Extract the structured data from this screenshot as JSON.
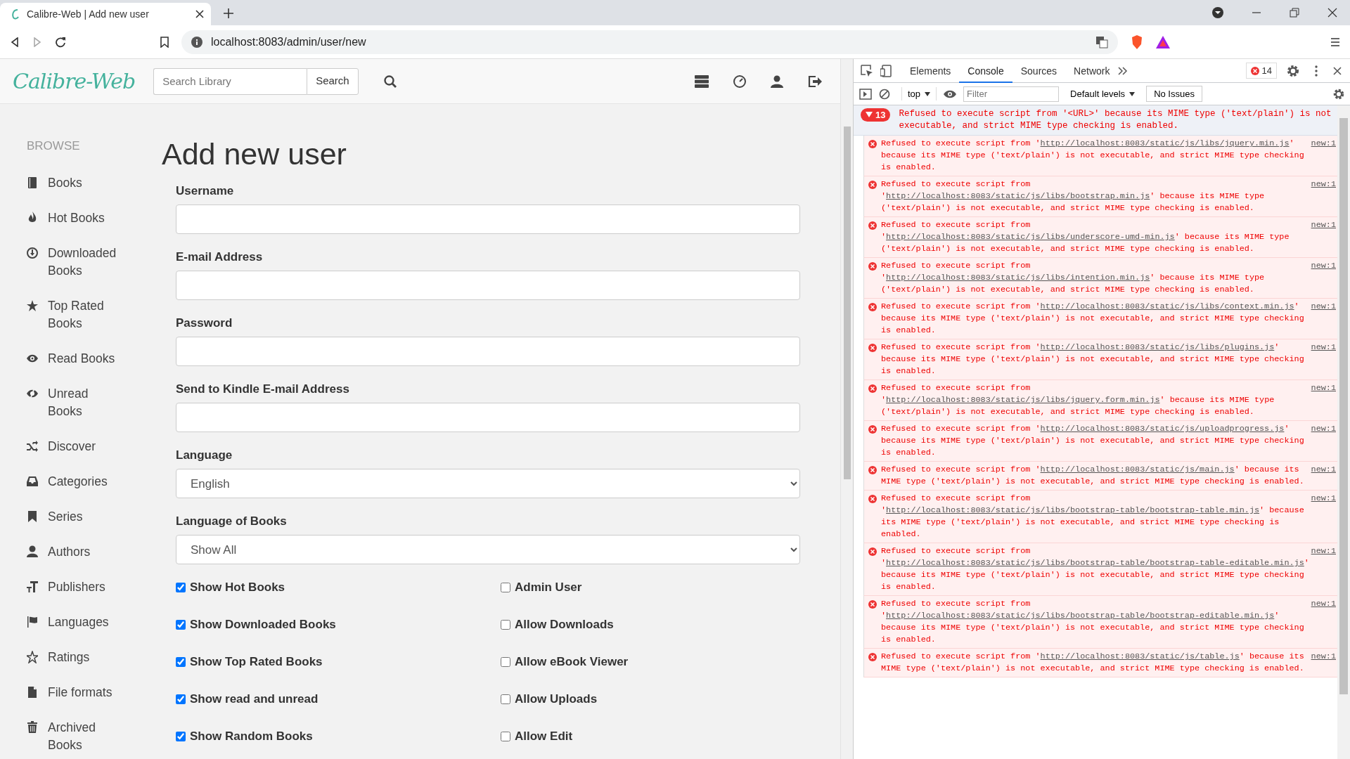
{
  "browser": {
    "tab_title": "Calibre-Web | Add new user",
    "url": "localhost:8083/admin/user/new"
  },
  "header": {
    "logo": "Calibre-Web",
    "search_placeholder": "Search Library",
    "search_button": "Search"
  },
  "sidebar": {
    "heading": "BROWSE",
    "items": [
      {
        "label": "Books"
      },
      {
        "label": "Hot Books"
      },
      {
        "label": "Downloaded Books"
      },
      {
        "label": "Top Rated Books"
      },
      {
        "label": "Read Books"
      },
      {
        "label": "Unread Books"
      },
      {
        "label": "Discover"
      },
      {
        "label": "Categories"
      },
      {
        "label": "Series"
      },
      {
        "label": "Authors"
      },
      {
        "label": "Publishers"
      },
      {
        "label": "Languages"
      },
      {
        "label": "Ratings"
      },
      {
        "label": "File formats"
      },
      {
        "label": "Archived Books"
      }
    ]
  },
  "form": {
    "title": "Add new user",
    "fields": [
      {
        "label": "Username",
        "kind": "text"
      },
      {
        "label": "E-mail Address",
        "kind": "text"
      },
      {
        "label": "Password",
        "kind": "password"
      },
      {
        "label": "Send to Kindle E-mail Address",
        "kind": "text"
      },
      {
        "label": "Language",
        "kind": "select",
        "value": "English"
      },
      {
        "label": "Language of Books",
        "kind": "select",
        "value": "Show All"
      }
    ],
    "checkboxes_left": [
      {
        "label": "Show Hot Books",
        "checked": true
      },
      {
        "label": "Show Downloaded Books",
        "checked": true
      },
      {
        "label": "Show Top Rated Books",
        "checked": true
      },
      {
        "label": "Show read and unread",
        "checked": true
      },
      {
        "label": "Show Random Books",
        "checked": true
      }
    ],
    "checkboxes_right": [
      {
        "label": "Admin User",
        "checked": false
      },
      {
        "label": "Allow Downloads",
        "checked": false
      },
      {
        "label": "Allow eBook Viewer",
        "checked": false
      },
      {
        "label": "Allow Uploads",
        "checked": false
      },
      {
        "label": "Allow Edit",
        "checked": false
      }
    ]
  },
  "devtools": {
    "tabs": [
      {
        "label": "Elements",
        "selected": false
      },
      {
        "label": "Console",
        "selected": true
      },
      {
        "label": "Sources",
        "selected": false
      },
      {
        "label": "Network",
        "selected": false
      }
    ],
    "error_count": "14",
    "context": "top",
    "filter_placeholder": "Filter",
    "levels": "Default levels",
    "issues": "No Issues",
    "group": {
      "count": "13",
      "expanded": true,
      "text": "Refused to execute script from '<URL>' because its MIME type ('text/plain') is not executable, and strict MIME type checking is enabled."
    },
    "messages": [
      {
        "prefix": "Refused to execute script from '",
        "url": "http://localhost:8083/static/js/libs/jquery.min.js",
        "suffix": "' because its MIME type ('text/plain') is not executable, and strict MIME type checking is enabled.",
        "source": "new:1"
      },
      {
        "prefix": "Refused to execute script from '",
        "url": "http://localhost:8083/static/js/libs/bootstrap.min.js",
        "suffix": "' because its MIME type ('text/plain') is not executable, and strict MIME type checking is enabled.",
        "source": "new:1"
      },
      {
        "prefix": "Refused to execute script from '",
        "url": "http://localhost:8083/static/js/libs/underscore-umd-min.js",
        "suffix": "' because its MIME type ('text/plain') is not executable, and strict MIME type checking is enabled.",
        "source": "new:1"
      },
      {
        "prefix": "Refused to execute script from '",
        "url": "http://localhost:8083/static/js/libs/intention.min.js",
        "suffix": "' because its MIME type ('text/plain') is not executable, and strict MIME type checking is enabled.",
        "source": "new:1"
      },
      {
        "prefix": "Refused to execute script from '",
        "url": "http://localhost:8083/static/js/libs/context.min.js",
        "suffix": "' because its MIME type ('text/plain') is not executable, and strict MIME type checking is enabled.",
        "source": "new:1"
      },
      {
        "prefix": "Refused to execute script from '",
        "url": "http://localhost:8083/static/js/libs/plugins.js",
        "suffix": "' because its MIME type ('text/plain') is not executable, and strict MIME type checking is enabled.",
        "source": "new:1"
      },
      {
        "prefix": "Refused to execute script from '",
        "url": "http://localhost:8083/static/js/libs/jquery.form.min.js",
        "suffix": "' because its MIME type ('text/plain') is not executable, and strict MIME type checking is enabled.",
        "source": "new:1"
      },
      {
        "prefix": "Refused to execute script from '",
        "url": "http://localhost:8083/static/js/uploadprogress.js",
        "suffix": "' because its MIME type ('text/plain') is not executable, and strict MIME type checking is enabled.",
        "source": "new:1"
      },
      {
        "prefix": "Refused to execute script from '",
        "url": "http://localhost:8083/static/js/main.js",
        "suffix": "' because its MIME type ('text/plain') is not executable, and strict MIME type checking is enabled.",
        "source": "new:1"
      },
      {
        "prefix": "Refused to execute script from '",
        "url": "http://localhost:8083/static/js/libs/bootstrap-table/bootstrap-table.min.js",
        "suffix": "' because its MIME type ('text/plain') is not executable, and strict MIME type checking is enabled.",
        "source": "new:1"
      },
      {
        "prefix": "Refused to execute script from '",
        "url": "http://localhost:8083/static/js/libs/bootstrap-table/bootstrap-table-editable.min.js",
        "suffix": "' because its MIME type ('text/plain') is not executable, and strict MIME type checking is enabled.",
        "source": "new:1"
      },
      {
        "prefix": "Refused to execute script from '",
        "url": "http://localhost:8083/static/js/libs/bootstrap-table/bootstrap-editable.min.js",
        "suffix": "' because its MIME type ('text/plain') is not executable, and strict MIME type checking is enabled.",
        "source": "new:1"
      },
      {
        "prefix": "Refused to execute script from '",
        "url": "http://localhost:8083/static/js/table.js",
        "suffix": "' because its MIME type ('text/plain') is not executable, and strict MIME type checking is enabled.",
        "source": "new:1"
      }
    ]
  }
}
